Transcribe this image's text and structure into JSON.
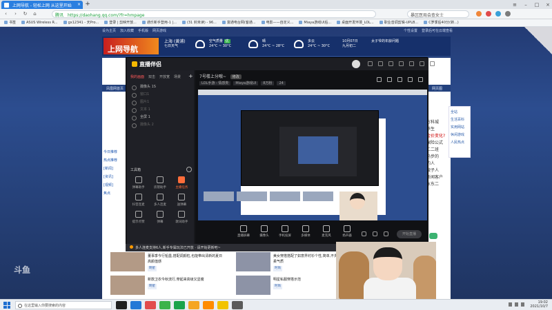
{
  "browser": {
    "tab_title": "上网导航 - 轻松上网 从这里开始",
    "tab_close": "×",
    "new_tab": "+",
    "url_secure_label": "腾讯",
    "url": "https://daohang.qq.com/?fr=hmpage",
    "search_placeholder": "暴区医局会查女士",
    "window_controls": [
      "≡",
      "–",
      "□",
      "×"
    ],
    "nav": [
      "‹",
      "›",
      "↻",
      "⌂"
    ],
    "bookmarks": [
      "书签",
      "ASUS Wireless R...",
      "gx12341 - 天Pro...",
      "登录 | 剪映开放...",
      "通乐新手登用-1 |...",
      "(31 封未读) - 96...",
      "富通电台网(客通...",
      "电影——自定义...",
      "Miaya游戏UI后...",
      "桌面开发环境_LOL...",
      "职业音调剪辑-UPLB...",
      "C罗季后40分(转...)"
    ],
    "icon_colors": [
      "#f0873a",
      "#e04a4a",
      "#3aa0d8",
      "#7c7c7c"
    ]
  },
  "page": {
    "topnav": [
      "设为主页",
      "加入收藏",
      "手机版",
      "网页游戏"
    ],
    "topnav_right": [
      "个性设置",
      "登录后可在云端查看"
    ],
    "logo": "上网导航",
    "weather": [
      {
        "city": "上海 (黄浦)",
        "sub": "七日天气"
      },
      {
        "city": "空气质量",
        "sub": "24°C ~ 30°C",
        "badge": "优"
      },
      {
        "city": "晴",
        "sub": "24°C ~ 28°C"
      },
      {
        "city": "多云",
        "sub": "24°C ~ 30°C"
      }
    ],
    "calendar": {
      "date": "10月07日",
      "day": "九月初二",
      "note": "太子爷的年龄问题"
    },
    "pagebar_left": "凤凰网首页",
    "pagebar_right": "网页图",
    "right_panel": [
      "全站",
      "生活百科",
      "实用网站",
      "休闲游戏",
      "人民热点"
    ],
    "right_col": [
      "万科城",
      "养生",
      "金价变化?",
      "保险公式",
      "二二班",
      "马步的",
      "的人",
      "被子人",
      "新闻客户",
      "东东二"
    ],
    "side_left": [
      "今日推荐",
      "热点推荐",
      "[新闻]",
      "[资讯]",
      "[视频]",
      "焦点"
    ]
  },
  "app": {
    "logo": "直播伴侣",
    "scene_tabs": [
      "我的画面",
      "双击",
      "开放宽",
      "场景"
    ],
    "scene_add": "+",
    "sources": [
      {
        "label": "摄像头 1S",
        "dim": false
      },
      {
        "label": "窗口1",
        "dim": true
      },
      {
        "label": "图片1",
        "dim": true
      },
      {
        "label": "文本 1",
        "dim": true
      },
      {
        "label": "全屏 1",
        "dim": false
      },
      {
        "label": "摄像头 2",
        "dim": true
      }
    ],
    "tools_title": "工具箱",
    "tools": [
      {
        "label": "弹幕助手",
        "hl": false
      },
      {
        "label": "房管助手",
        "hl": false
      },
      {
        "label": "主播任务",
        "hl": true
      },
      {
        "label": "抖音连麦",
        "hl": false
      },
      {
        "label": "多人连麦",
        "hl": false
      },
      {
        "label": "送弹幕",
        "hl": false
      },
      {
        "label": "提示点赞",
        "hl": false
      },
      {
        "label": "弹幕",
        "hl": false
      },
      {
        "label": "歌词助手",
        "hl": false
      }
    ],
    "main_title": "7号楼上分哦~",
    "main_tag": "修改",
    "main_sub": [
      "LOL手游 - 情感类",
      "Miaya游戏UI",
      "8万粉",
      "24"
    ],
    "bottom_tools": [
      "直播屏幕",
      "摄像头",
      "手机投屏",
      "多媒体",
      "麦克风",
      "扬声器"
    ],
    "go_live": "开始直播",
    "notice": "多人连麦支持6人,新手专属玩法已开放 · 请开始更新吧~"
  },
  "news": [
    {
      "title": "董事季今行铅墨,搭配调颜粒,也能带出清新的夏日高颜值感",
      "tag": "明星",
      "title2": "美女穿搭搭配了如意界衬衫个性,简单,不失温柔气质",
      "tag2": "时尚"
    },
    {
      "title": "新款卫衣今秋流行,穿起来高级又显瘦",
      "tag": "明星",
      "title2": "明星私服穿搭示范",
      "tag2": "时尚"
    }
  ],
  "watermark": "斗鱼",
  "taskbar": {
    "search": "在这里输入你要搜索的内容",
    "time": "19:02",
    "date": "2021/10/7",
    "app_colors": [
      "#1f1f1f",
      "#2478d6",
      "#e24c4c",
      "#3bb34a",
      "#1aa34a",
      "#f5a623",
      "#ff8c00",
      "#f2c300",
      "#5a5a5a"
    ]
  },
  "colors": {
    "accent": "#2a7fe0",
    "page_bg": "#233b74",
    "app_bg": "#17181c",
    "highlight": "#ff6d3a"
  }
}
